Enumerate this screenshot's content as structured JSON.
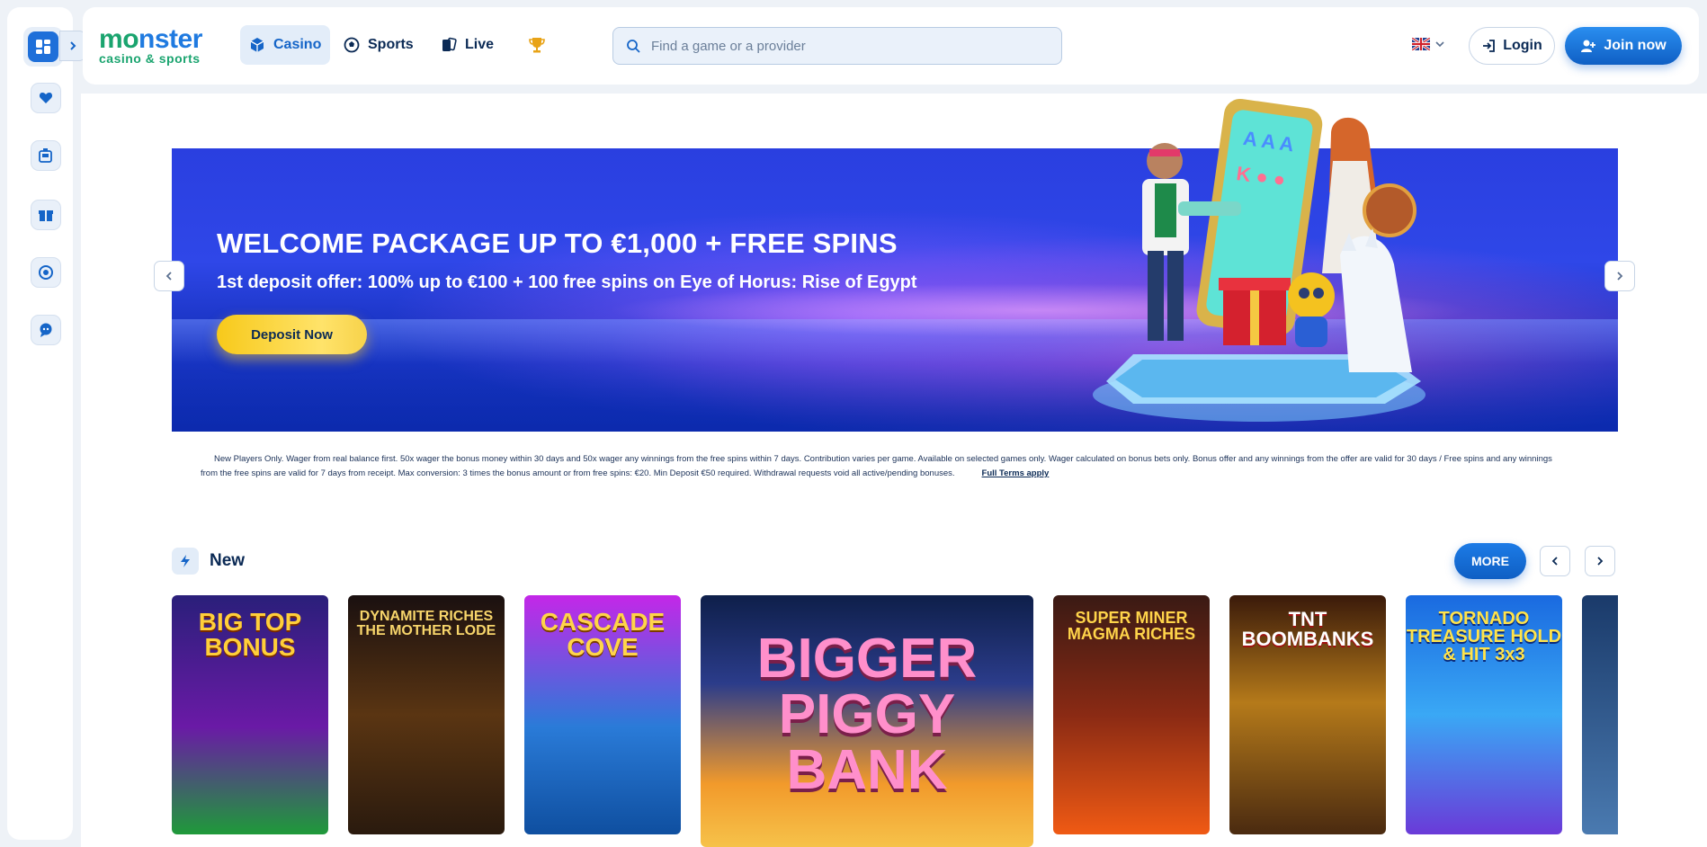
{
  "sidebar": {
    "items": [
      "menu-grid",
      "favorites",
      "casino-chips",
      "promotions",
      "vip",
      "support"
    ]
  },
  "header": {
    "logo_line1a": "m",
    "logo_line1b": "nster",
    "logo_line2": "casino & sports",
    "nav": [
      {
        "label": "Casino",
        "icon": "cube-icon"
      },
      {
        "label": "Sports",
        "icon": "soccer-ball-icon"
      },
      {
        "label": "Live",
        "icon": "cards-icon"
      }
    ],
    "search_placeholder": "Find a game or a provider",
    "login_label": "Login",
    "join_label": "Join now"
  },
  "banner": {
    "title": "WELCOME PACKAGE UP TO €1,000 + FREE SPINS",
    "subtitle": "1st deposit offer: 100% up to €100 + 100 free spins on Eye of Horus: Rise of Egypt",
    "cta": "Deposit Now"
  },
  "terms": {
    "text1": "New Players Only. Wager from real balance first. 50x wager the bonus money within 30 days and 50x wager any winnings from the free spins within 7 days. Contribution varies per game. Available on selected games only. Wager calculated on bonus bets only. Bonus offer and any winnings from the offer are valid for 30 days / Free spins and any winnings",
    "text2": "from the free spins are valid for 7 days from receipt. Max conversion: 3 times the bonus amount or from free spins: €20. Min Deposit €50 required. Withdrawal requests void all active/pending bonuses.",
    "link": "Full Terms apply"
  },
  "section": {
    "title": "New",
    "more": "MORE"
  },
  "games": [
    {
      "title": "BIG TOP BONUS"
    },
    {
      "title": "DYNAMITE RICHES THE MOTHER LODE"
    },
    {
      "title": "CASCADE COVE"
    },
    {
      "title": "BIGGER PIGGY BANK"
    },
    {
      "title": "SUPER MINER MAGMA RICHES"
    },
    {
      "title": "TNT BOOMBANKS"
    },
    {
      "title": "TORNADO TREASURE HOLD & HIT 3x3"
    }
  ],
  "colors": {
    "primary": "#1565c8",
    "accent_yellow": "#f7c91a",
    "text_dark": "#0b2a55"
  }
}
